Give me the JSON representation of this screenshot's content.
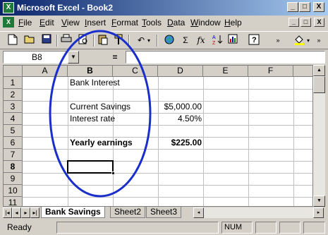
{
  "window": {
    "title": "Microsoft Excel - Book2",
    "minimize": "_",
    "maximize": "□",
    "close": "X"
  },
  "menu": {
    "items": [
      {
        "label": "File"
      },
      {
        "label": "Edit"
      },
      {
        "label": "View"
      },
      {
        "label": "Insert"
      },
      {
        "label": "Format"
      },
      {
        "label": "Tools"
      },
      {
        "label": "Data"
      },
      {
        "label": "Window"
      },
      {
        "label": "Help"
      }
    ]
  },
  "toolbar": {
    "buttons": [
      "new-icon",
      "open-icon",
      "save-icon",
      "print-icon",
      "print-preview-icon",
      "paste-icon",
      "format-painter-icon",
      "undo-icon",
      "hyperlink-icon",
      "autosum-icon",
      "function-icon",
      "sort-icon",
      "help-icon",
      "fill-color-icon"
    ],
    "autosum_glyph": "Σ",
    "function_glyph": "fx"
  },
  "formula_bar": {
    "name_box": "B8",
    "equals": "=",
    "formula": ""
  },
  "grid": {
    "columns": [
      "A",
      "B",
      "C",
      "D",
      "E",
      "F"
    ],
    "rows": [
      "1",
      "2",
      "3",
      "4",
      "5",
      "6",
      "7",
      "8",
      "9",
      "10",
      "11"
    ],
    "cells": {
      "B1": "Bank Interest",
      "B3": "Current Savings",
      "D3": "$5,000.00",
      "B4": "Interest rate",
      "D4": "4.50%",
      "B6": "Yearly earnings",
      "D6": "$225.00"
    },
    "active_cell": "B8"
  },
  "sheets": {
    "tabs": [
      "Bank Savings",
      "Sheet2",
      "Sheet3"
    ],
    "active": "Bank Savings"
  },
  "status": {
    "text": "Ready",
    "num": "NUM"
  },
  "colors": {
    "title_gradient_start": "#0a246a",
    "title_gradient_end": "#a6caf0",
    "annotation": "#1a2ecc"
  }
}
